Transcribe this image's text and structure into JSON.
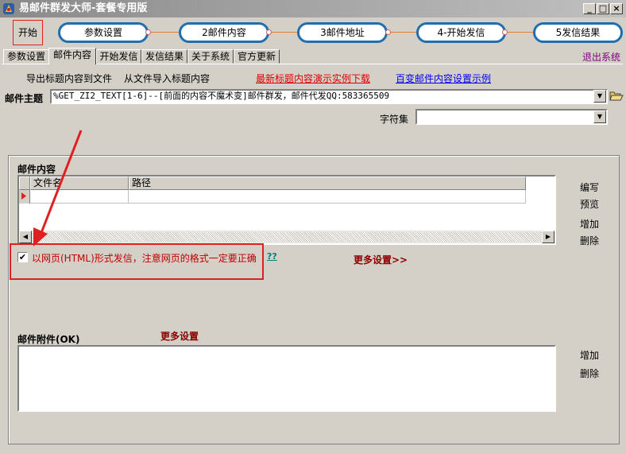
{
  "window": {
    "title": "易邮件群发大师-套餐专用版",
    "min_glyph": "_",
    "max_glyph": "□",
    "close_glyph": "×"
  },
  "wizard": {
    "start_label": "开始",
    "steps": [
      "参数设置",
      "2邮件内容",
      "3邮件地址",
      "4-开始发信",
      "5发信结果"
    ]
  },
  "tabs": [
    {
      "label": "参数设置",
      "active": false
    },
    {
      "label": "邮件内容",
      "active": true
    },
    {
      "label": "开始发信",
      "active": false
    },
    {
      "label": "发信结果",
      "active": false
    },
    {
      "label": "关于系统",
      "active": false
    },
    {
      "label": "官方更新",
      "active": false
    }
  ],
  "exit_label": "退出系统",
  "toolbar": {
    "export_titles": "导出标题内容到文件",
    "import_titles": "从文件导入标题内容",
    "demo_link": "最新标题内容演示实例下载",
    "sample_link": "百变邮件内容设置示例"
  },
  "subject": {
    "label": "邮件主题",
    "value": "%GET_ZI2_TEXT[1-6]--[前面的内容不魔术变]邮件群发，邮件代发QQ:583365509"
  },
  "charset": {
    "label": "字符集",
    "value": ""
  },
  "content": {
    "section_label": "邮件内容",
    "columns": [
      "文件名",
      "路径"
    ],
    "rows": [
      [
        "",
        ""
      ]
    ],
    "side_actions": [
      "编写",
      "预览",
      "增加",
      "删除"
    ]
  },
  "html_option": {
    "checked": true,
    "check_glyph": "✔",
    "label": "以网页(HTML)形式发信，注意网页的格式一定要正确",
    "help_link": "??",
    "more_settings": "更多设置>>"
  },
  "attachment": {
    "section_label": "邮件附件(OK)",
    "more_settings": "更多设置",
    "side_actions": [
      "增加",
      "删除"
    ]
  },
  "colors": {
    "window_bg": "#d4d0c8",
    "accent_red": "#e02020",
    "step_border": "#1f6fb0",
    "more_settings": "#8b0000",
    "help_link": "#008080",
    "exit_link": "#800080"
  }
}
